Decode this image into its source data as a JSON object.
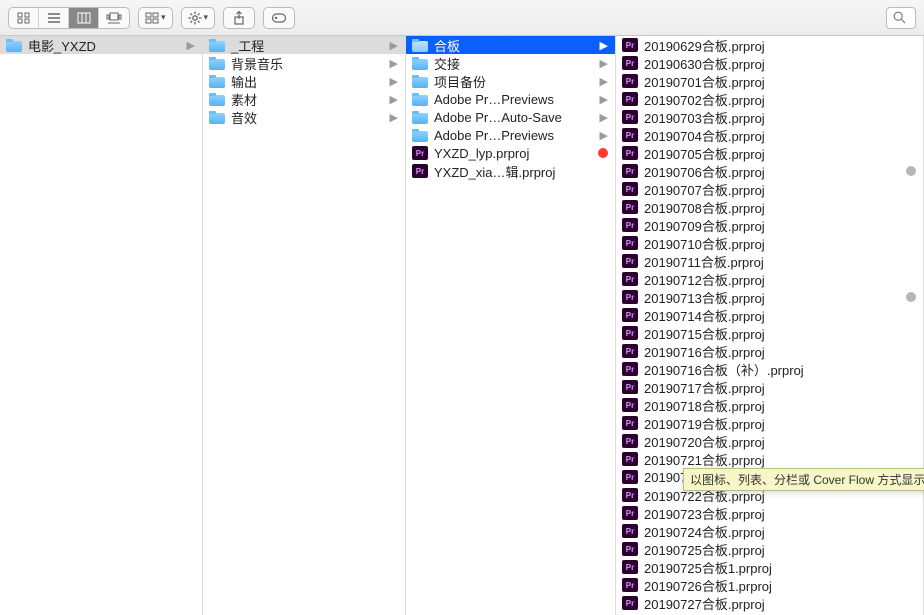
{
  "tooltip": "以图标、列表、分栏或 Cover Flow 方式显示项",
  "columns": [
    {
      "width_class": "col0",
      "selectedIndex": 0,
      "selectionActive": false,
      "items": [
        {
          "type": "folder",
          "name": "电影_YXZD",
          "hasChildren": true
        }
      ]
    },
    {
      "width_class": "col1",
      "selectedIndex": 0,
      "selectionActive": false,
      "items": [
        {
          "type": "folder",
          "name": "_工程",
          "hasChildren": true
        },
        {
          "type": "folder",
          "name": "背景音乐",
          "hasChildren": true
        },
        {
          "type": "folder",
          "name": "输出",
          "hasChildren": true
        },
        {
          "type": "folder",
          "name": "素材",
          "hasChildren": true
        },
        {
          "type": "folder",
          "name": "音效",
          "hasChildren": true
        }
      ]
    },
    {
      "width_class": "col2",
      "selectedIndex": 0,
      "selectionActive": true,
      "items": [
        {
          "type": "folder",
          "name": "合板",
          "hasChildren": true
        },
        {
          "type": "folder",
          "name": "交接",
          "hasChildren": true
        },
        {
          "type": "folder",
          "name": "项目备份",
          "hasChildren": true
        },
        {
          "type": "folder",
          "name": "Adobe Pr…Previews",
          "hasChildren": true
        },
        {
          "type": "folder",
          "name": "Adobe Pr…Auto-Save",
          "hasChildren": true
        },
        {
          "type": "folder",
          "name": "Adobe Pr…Previews",
          "hasChildren": true
        },
        {
          "type": "pr",
          "name": "YXZD_lyp.prproj",
          "tag": "#ff3b30"
        },
        {
          "type": "pr",
          "name": "YXZD_xia…辑.prproj"
        }
      ]
    },
    {
      "width_class": "col3",
      "selectedIndex": -1,
      "selectionActive": false,
      "items": [
        {
          "type": "pr",
          "name": "20190629合板.prproj"
        },
        {
          "type": "pr",
          "name": "20190630合板.prproj"
        },
        {
          "type": "pr",
          "name": "20190701合板.prproj"
        },
        {
          "type": "pr",
          "name": "20190702合板.prproj"
        },
        {
          "type": "pr",
          "name": "20190703合板.prproj"
        },
        {
          "type": "pr",
          "name": "20190704合板.prproj"
        },
        {
          "type": "pr",
          "name": "20190705合板.prproj"
        },
        {
          "type": "pr",
          "name": "20190706合板.prproj",
          "tag": "#b6b6b6"
        },
        {
          "type": "pr",
          "name": "20190707合板.prproj"
        },
        {
          "type": "pr",
          "name": "20190708合板.prproj"
        },
        {
          "type": "pr",
          "name": "20190709合板.prproj"
        },
        {
          "type": "pr",
          "name": "20190710合板.prproj"
        },
        {
          "type": "pr",
          "name": "20190711合板.prproj"
        },
        {
          "type": "pr",
          "name": "20190712合板.prproj"
        },
        {
          "type": "pr",
          "name": "20190713合板.prproj",
          "tag": "#b6b6b6"
        },
        {
          "type": "pr",
          "name": "20190714合板.prproj"
        },
        {
          "type": "pr",
          "name": "20190715合板.prproj"
        },
        {
          "type": "pr",
          "name": "20190716合板.prproj"
        },
        {
          "type": "pr",
          "name": "20190716合板（补）.prproj"
        },
        {
          "type": "pr",
          "name": "20190717合板.prproj"
        },
        {
          "type": "pr",
          "name": "20190718合板.prproj"
        },
        {
          "type": "pr",
          "name": "20190719合板.prproj"
        },
        {
          "type": "pr",
          "name": "20190720合板.prproj"
        },
        {
          "type": "pr",
          "name": "20190721合板.prproj"
        },
        {
          "type": "pr",
          "name": "201907"
        },
        {
          "type": "pr",
          "name": "20190722合板.prproj"
        },
        {
          "type": "pr",
          "name": "20190723合板.prproj"
        },
        {
          "type": "pr",
          "name": "20190724合板.prproj"
        },
        {
          "type": "pr",
          "name": "20190725合板.prproj"
        },
        {
          "type": "pr",
          "name": "20190725合板1.prproj"
        },
        {
          "type": "pr",
          "name": "20190726合板1.prproj"
        },
        {
          "type": "pr",
          "name": "20190727合板.prproj"
        }
      ]
    }
  ]
}
